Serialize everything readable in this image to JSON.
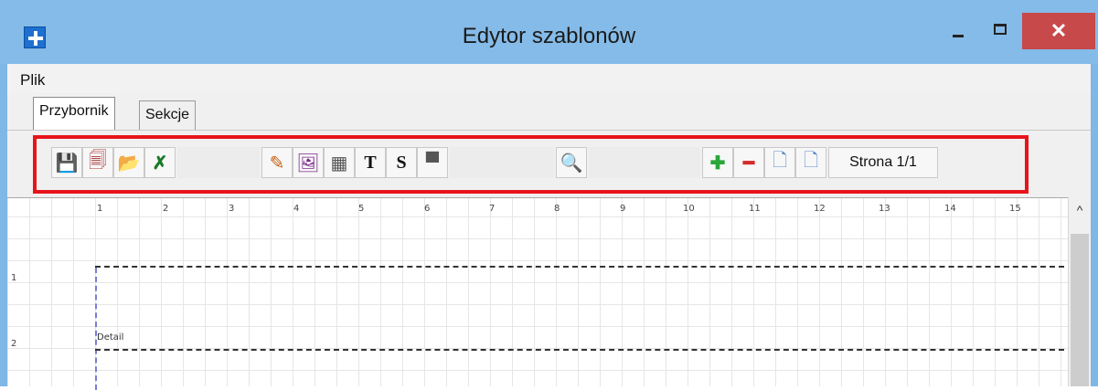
{
  "window": {
    "title": "Edytor szablonów",
    "close_glyph": "✕"
  },
  "menu": {
    "items": [
      "Plik"
    ]
  },
  "tabs": [
    {
      "label": "Przybornik",
      "active": true
    },
    {
      "label": "Sekcje",
      "active": false
    }
  ],
  "toolbar": {
    "buttons": [
      {
        "name": "save-icon",
        "glyph": "💾"
      },
      {
        "name": "save-as-icon",
        "glyph": "🗐"
      },
      {
        "name": "open-folder-icon",
        "glyph": "📂"
      },
      {
        "name": "clear-icon",
        "glyph": "✗"
      },
      {
        "name": "pen-icon",
        "glyph": "✎"
      },
      {
        "name": "image-icon",
        "glyph": "🖼"
      },
      {
        "name": "barcode-icon",
        "glyph": "▦"
      },
      {
        "name": "text-icon",
        "glyph": "T"
      },
      {
        "name": "s-icon",
        "glyph": "S"
      },
      {
        "name": "text-block-icon",
        "glyph": "▀"
      },
      {
        "name": "zoom-icon",
        "glyph": "🔍"
      },
      {
        "name": "add-icon",
        "glyph": "✚"
      },
      {
        "name": "remove-icon",
        "glyph": "━"
      },
      {
        "name": "page-prev-icon",
        "glyph": "🗋"
      },
      {
        "name": "page-next-icon",
        "glyph": "🗋"
      }
    ],
    "page_label": "Strona 1/1"
  },
  "canvas": {
    "ruler_top": [
      "1",
      "2",
      "3",
      "4",
      "5",
      "6",
      "7",
      "8",
      "9",
      "10",
      "11",
      "12",
      "13",
      "14",
      "15"
    ],
    "ruler_left": [
      "1",
      "2"
    ],
    "section_label": "Detail"
  },
  "scrollbar": {
    "up_glyph": "^"
  }
}
